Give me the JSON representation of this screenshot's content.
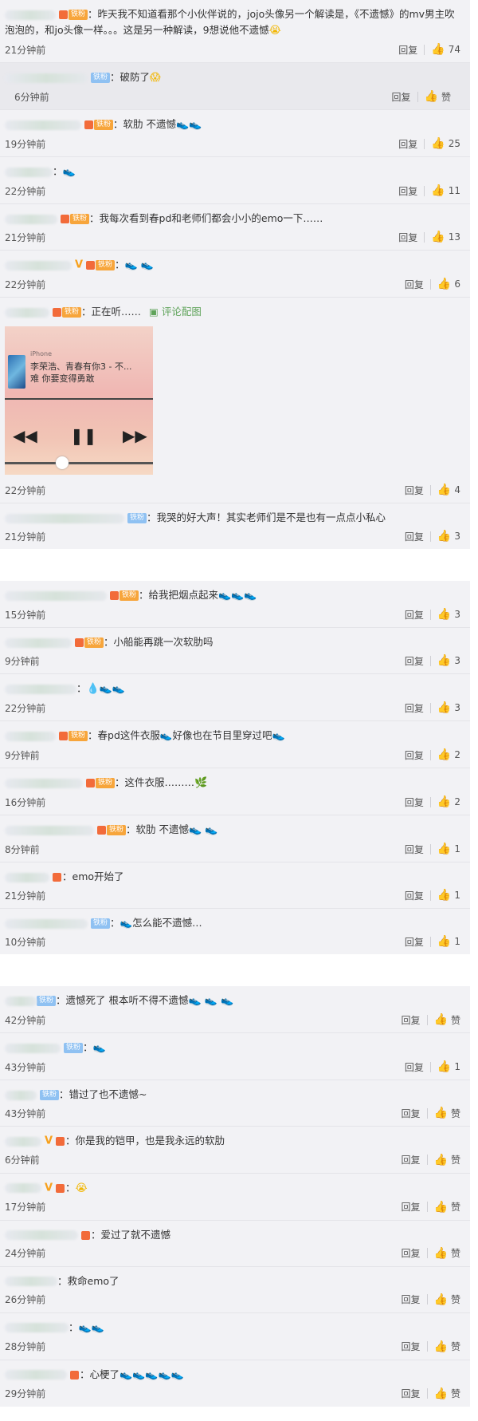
{
  "ui": {
    "reply": "回复",
    "like_word": "赞",
    "fan_badge": "铁粉",
    "image_link": "评论配图",
    "vip_mark": "V"
  },
  "group1": [
    {
      "time": "21分钟前",
      "likes": "74",
      "text": "昨天我不知道看那个小伙伴说的，jojo头像另一个解读是，《不遗憾》的mv男主吹泡泡的，和jo头像一样。。。这是另一种解读，9想说他不遗憾",
      "emojis": "😭"
    },
    {
      "time": "6分钟前",
      "likes": "赞",
      "text": "破防了",
      "emojis": "😱"
    },
    {
      "time": "19分钟前",
      "likes": "25",
      "text": "软肋 不遗憾",
      "emojis": "👟👟"
    },
    {
      "time": "22分钟前",
      "likes": "11",
      "text": "",
      "emojis": "👟"
    },
    {
      "time": "21分钟前",
      "likes": "13",
      "text": "我每次看到春pd和老师们都会小小的emo一下……",
      "emojis": ""
    },
    {
      "time": "22分钟前",
      "likes": "6",
      "text": "",
      "emojis": "👟 👟"
    },
    {
      "time": "22分钟前",
      "likes": "4",
      "text": "正在听……",
      "emojis": ""
    },
    {
      "time": "21分钟前",
      "likes": "3",
      "text": "我哭的好大声！其实老师们是不是也有一点点小私心",
      "emojis": ""
    }
  ],
  "player": {
    "device": "iPhone",
    "title": "李荣浩、青春有你3 - 不...",
    "subtitle": "难 你要变得勇敢"
  },
  "group2": [
    {
      "time": "15分钟前",
      "likes": "3",
      "text": "给我把烟点起来",
      "emojis": "👟👟👟"
    },
    {
      "time": "9分钟前",
      "likes": "3",
      "text": "小船能再跳一次软肋吗",
      "emojis": ""
    },
    {
      "time": "22分钟前",
      "likes": "3",
      "text": "",
      "emojis": "💧👟👟"
    },
    {
      "time": "9分钟前",
      "likes": "2",
      "text": "春pd这件衣服👟好像也在节目里穿过吧",
      "emojis": "👟"
    },
    {
      "time": "16分钟前",
      "likes": "2",
      "text": "这件衣服………",
      "emojis": "🌿"
    },
    {
      "time": "8分钟前",
      "likes": "1",
      "text": "软肋 不遗憾",
      "emojis": "👟 👟"
    },
    {
      "time": "21分钟前",
      "likes": "1",
      "text": "emo开始了",
      "emojis": ""
    },
    {
      "time": "10分钟前",
      "likes": "1",
      "text": "👟怎么能不遗憾…",
      "emojis": ""
    }
  ],
  "group3": [
    {
      "time": "42分钟前",
      "likes": "赞",
      "text": "遗憾死了 根本听不得不遗憾",
      "emojis": "👟 👟 👟"
    },
    {
      "time": "43分钟前",
      "likes": "1",
      "text": "",
      "emojis": "👟"
    },
    {
      "time": "43分钟前",
      "likes": "赞",
      "text": "错过了也不遗憾~",
      "emojis": ""
    },
    {
      "time": "6分钟前",
      "likes": "赞",
      "text": "你是我的铠甲，也是我永远的软肋",
      "emojis": ""
    },
    {
      "time": "17分钟前",
      "likes": "赞",
      "text": "",
      "emojis": "😭"
    },
    {
      "time": "24分钟前",
      "likes": "赞",
      "text": "爱过了就不遗憾",
      "emojis": ""
    },
    {
      "time": "26分钟前",
      "likes": "赞",
      "text": "救命emo了",
      "emojis": ""
    },
    {
      "time": "28分钟前",
      "likes": "赞",
      "text": "",
      "emojis": "👟👟"
    },
    {
      "time": "29分钟前",
      "likes": "赞",
      "text": "心梗了",
      "emojis": "👟👟👟👟👟"
    }
  ]
}
